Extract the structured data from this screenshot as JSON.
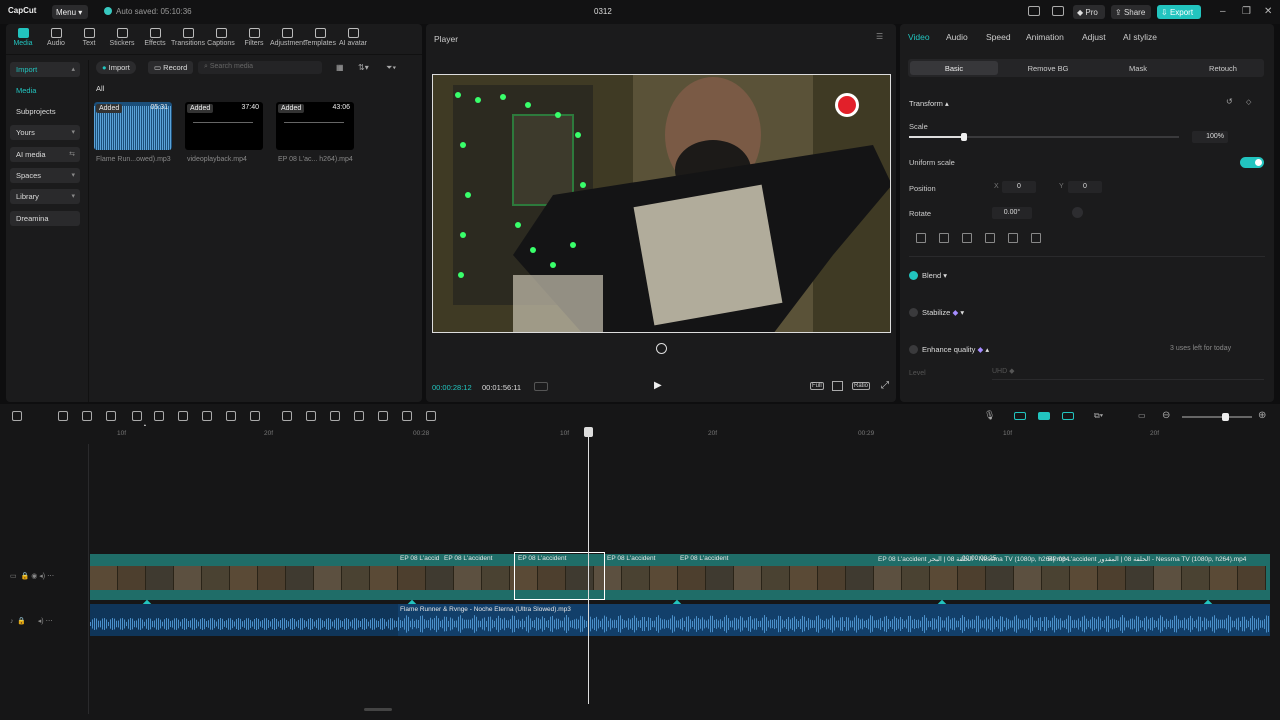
{
  "titlebar": {
    "app": "CapCut",
    "menu": "Menu",
    "autosave": "Auto saved: 05:10:36",
    "project": "0312",
    "pro": "Pro",
    "share": "Share",
    "export": "Export"
  },
  "toolbar": {
    "tabs": [
      "Media",
      "Audio",
      "Text",
      "Stickers",
      "Effects",
      "Transitions",
      "Captions",
      "Filters",
      "Adjustment",
      "Templates",
      "AI avatar"
    ]
  },
  "sidebar": {
    "items": [
      "Import",
      "Media",
      "Subprojects",
      "Yours",
      "AI media",
      "Spaces",
      "Library",
      "Dreamina"
    ]
  },
  "media": {
    "import": "Import",
    "record": "Record",
    "search_placeholder": "Search media",
    "filter_all": "All",
    "items": [
      {
        "tag": "Added",
        "duration": "05:31",
        "name": "Flame Run...owed).mp3"
      },
      {
        "tag": "Added",
        "duration": "37:40",
        "name": "videoplayback.mp4"
      },
      {
        "tag": "Added",
        "duration": "43:06",
        "name": "EP 08 L'ac... h264).mp4"
      }
    ]
  },
  "player": {
    "title": "Player",
    "current": "00:00:28:12",
    "total": "00:01:56:11",
    "full": "Full",
    "ratio": "Ratio"
  },
  "props": {
    "tabs": [
      "Video",
      "Audio",
      "Speed",
      "Animation",
      "Adjust",
      "AI stylize"
    ],
    "subtabs": [
      "Basic",
      "Remove BG",
      "Mask",
      "Retouch"
    ],
    "transform": "Transform",
    "scale": "Scale",
    "scale_val": "100%",
    "uniform": "Uniform scale",
    "position": "Position",
    "pos_x_label": "X",
    "pos_x": "0",
    "pos_y_label": "Y",
    "pos_y": "0",
    "rotate": "Rotate",
    "rotate_val": "0.00°",
    "blend": "Blend",
    "stabilize": "Stabilize",
    "enhance": "Enhance quality",
    "uses_left": "3 uses left for today",
    "level": "Level",
    "uhd": "UHD"
  },
  "timeline": {
    "ruler": [
      "10f",
      "20f",
      "00:28",
      "10f",
      "20f",
      "00:29",
      "10f",
      "20f"
    ],
    "video_clips": [
      "EP 08 L'accid",
      "EP 08 L'accident",
      "EP 08 L'accident",
      "EP 08 L'accident",
      "EP 08 L'accident",
      "EP 08 L'accident ﺍﻟﺤﻠﻘﺔ 08 | ﺍﻟﺒﺤﺮ - Nessma TV (1080p, h264).mp4",
      "00:00:00:25",
      "EP 08 L'accident ﺍﻟﺤﻠﻘﺔ 08 | ﺍﻟﻤﻘﺪﻭﺭ - Nessma TV (1080p, h264).mp4"
    ],
    "audio_clip": "Flame Runner & Rvnge - Noche Eterna (Ultra Slowed).mp3"
  },
  "colors": {
    "accent": "#22c4bf",
    "video_track": "#1f6d68",
    "audio_track": "#123f6a"
  }
}
